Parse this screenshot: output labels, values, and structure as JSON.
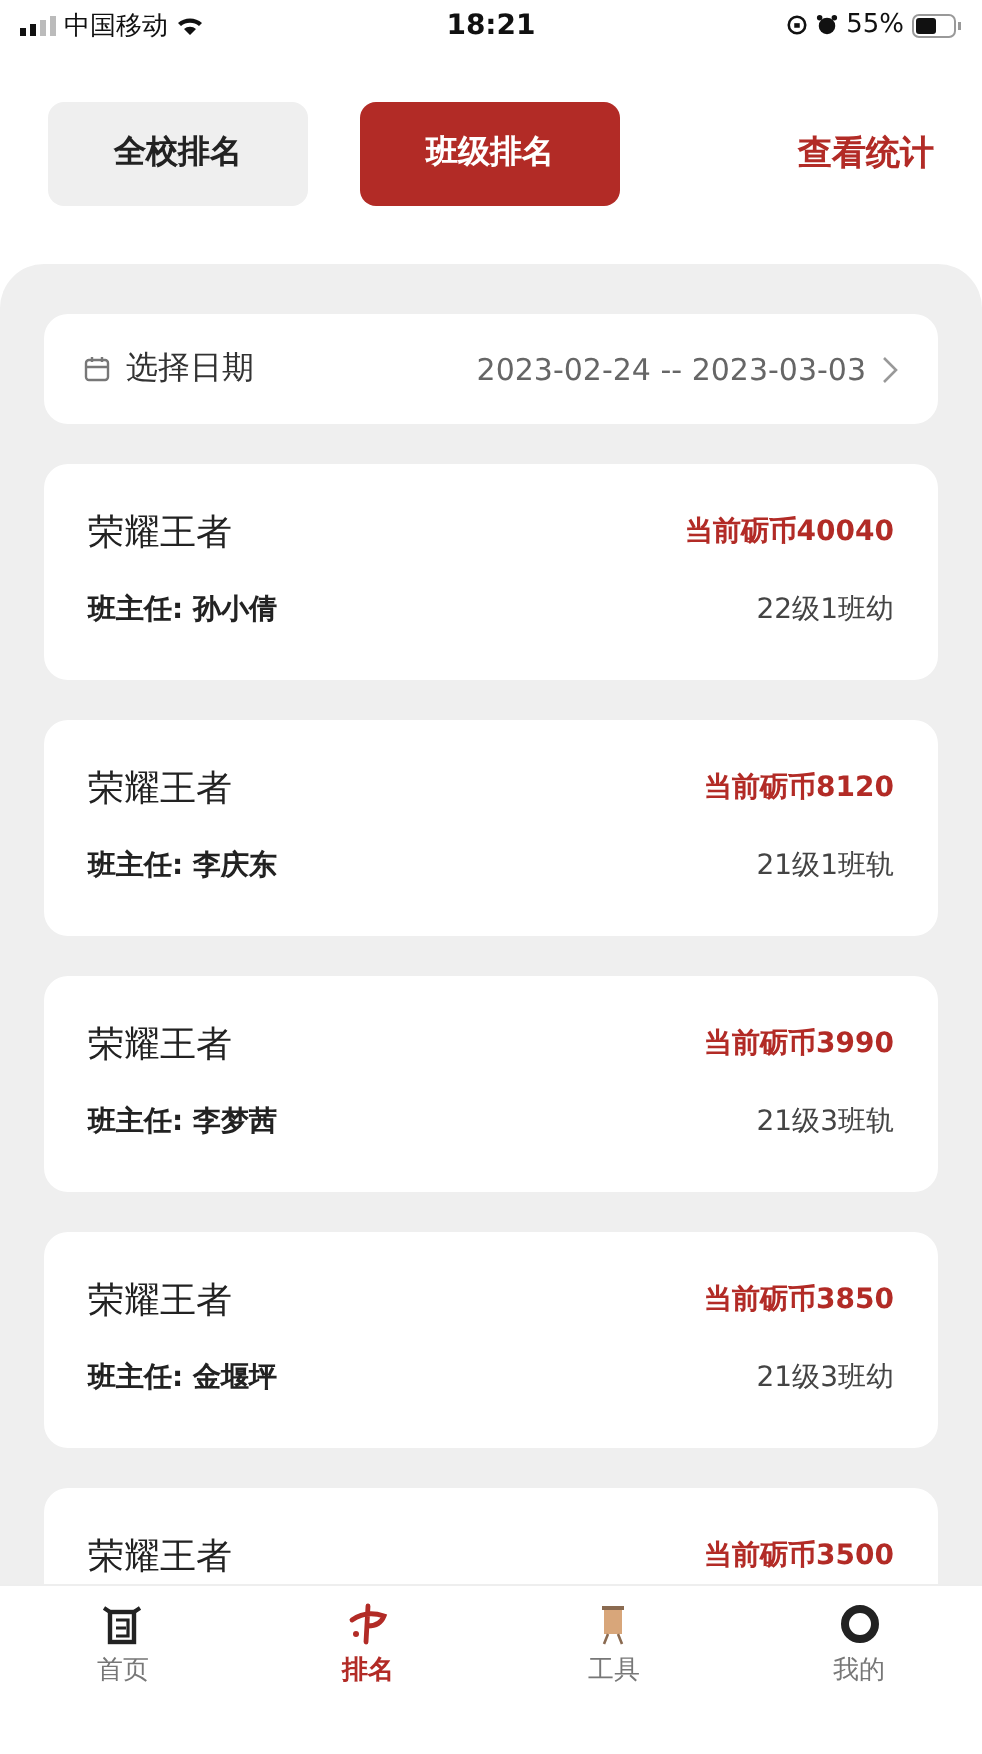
{
  "status_bar": {
    "carrier": "中国移动",
    "time": "18:21",
    "battery": "55%"
  },
  "tabs": [
    {
      "label": "全校排名",
      "selected": false
    },
    {
      "label": "班级排名",
      "selected": true
    }
  ],
  "stats_link": "查看统计",
  "date_filter": {
    "label": "选择日期",
    "range": "2023-02-24 -- 2023-03-03"
  },
  "classes": [
    {
      "title": "荣耀王者",
      "coins": "当前砺币40040",
      "teacher": "班主任: 孙小倩",
      "class_name": "22级1班幼"
    },
    {
      "title": "荣耀王者",
      "coins": "当前砺币8120",
      "teacher": "班主任: 李庆东",
      "class_name": "21级1班轨"
    },
    {
      "title": "荣耀王者",
      "coins": "当前砺币3990",
      "teacher": "班主任: 李梦茜",
      "class_name": "21级3班轨"
    },
    {
      "title": "荣耀王者",
      "coins": "当前砺币3850",
      "teacher": "班主任: 金堰坪",
      "class_name": "21级3班幼"
    },
    {
      "title": "荣耀王者",
      "coins": "当前砺币3500"
    }
  ],
  "nav": [
    {
      "label": "首页",
      "selected": false,
      "kind": "home"
    },
    {
      "label": "排名",
      "selected": true,
      "kind": "rank"
    },
    {
      "label": "工具",
      "selected": false,
      "kind": "tools"
    },
    {
      "label": "我的",
      "selected": false,
      "kind": "me"
    }
  ]
}
